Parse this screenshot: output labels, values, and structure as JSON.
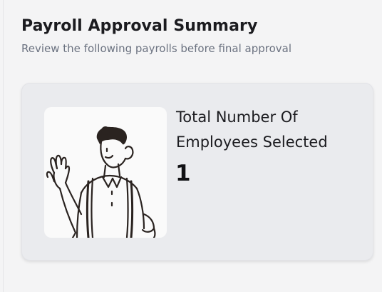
{
  "header": {
    "title": "Payroll Approval Summary",
    "subtitle": "Review the following payrolls before final approval"
  },
  "summary_card": {
    "illustration_icon": "waving-person-icon",
    "label": "Total Number Of Employees Selected",
    "value": "1"
  },
  "colors": {
    "card_background": "#eaebee",
    "page_background": "#f4f4f5",
    "text_primary": "#1b1b1f",
    "text_secondary": "#6b7280"
  }
}
